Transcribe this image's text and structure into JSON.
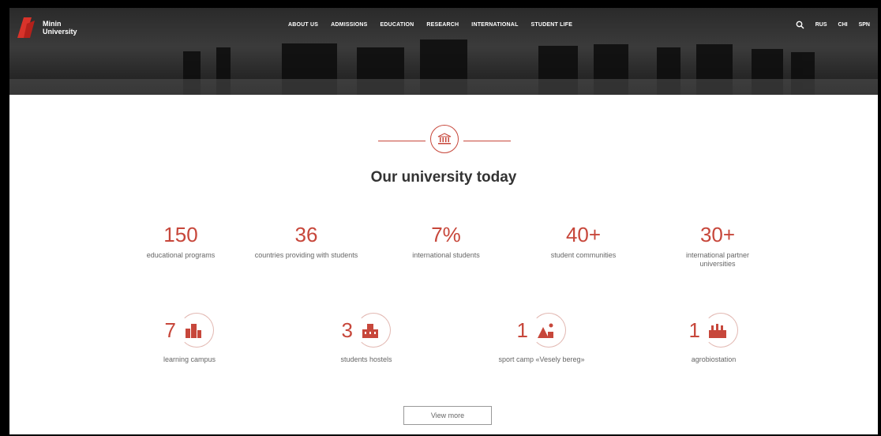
{
  "header": {
    "logo_line1": "Minin",
    "logo_line2": "University",
    "nav": [
      "ABOUT US",
      "ADMISSIONS",
      "EDUCATION",
      "RESEARCH",
      "INTERNATIONAL",
      "STUDENT LIFE"
    ],
    "languages": [
      "RUS",
      "CHI",
      "SPN"
    ]
  },
  "section": {
    "title": "Our university today"
  },
  "stats": [
    {
      "value": "150",
      "label": "educational programs"
    },
    {
      "value": "36",
      "label": "countries providing with students"
    },
    {
      "value": "7%",
      "label": "international students"
    },
    {
      "value": "40+",
      "label": "student communities"
    },
    {
      "value": "30+",
      "label": "international partner universities"
    }
  ],
  "facilities": [
    {
      "value": "7",
      "label": "learning campus",
      "icon": "campus-icon"
    },
    {
      "value": "3",
      "label": "students hostels",
      "icon": "hostel-icon"
    },
    {
      "value": "1",
      "label": "sport camp «Vesely bereg»",
      "icon": "sport-camp-icon"
    },
    {
      "value": "1",
      "label": "agrobiostation",
      "icon": "agrobiostation-icon"
    }
  ],
  "cta": {
    "view_more": "View more"
  },
  "colors": {
    "accent": "#c7473b"
  }
}
